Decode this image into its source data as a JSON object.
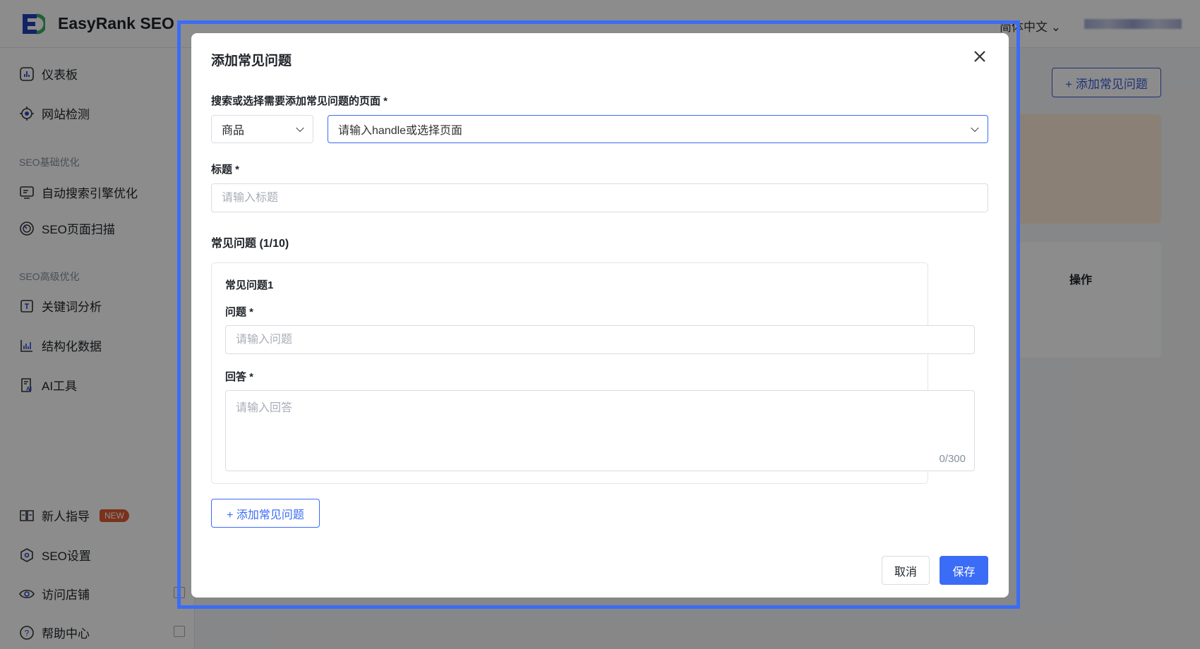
{
  "header": {
    "brand": "EasyRank SEO",
    "language": "简体中文"
  },
  "sidebar": {
    "items": [
      {
        "label": "仪表板",
        "icon": "dashboard-icon"
      },
      {
        "label": "网站检测",
        "icon": "target-icon"
      },
      {
        "label": "自动搜索引擎优化",
        "icon": "monitor-icon"
      },
      {
        "label": "SEO页面扫描",
        "icon": "scan-icon"
      },
      {
        "label": "关键词分析",
        "icon": "keyword-icon"
      },
      {
        "label": "结构化数据",
        "icon": "chart-icon"
      },
      {
        "label": "AI工具",
        "icon": "ai-doc-icon"
      },
      {
        "label": "新人指导",
        "icon": "book-icon",
        "badge": "NEW"
      },
      {
        "label": "SEO设置",
        "icon": "hexagon-settings-icon"
      },
      {
        "label": "访问店铺",
        "icon": "eye-icon"
      },
      {
        "label": "帮助中心",
        "icon": "help-icon"
      }
    ],
    "sections": [
      "SEO基础优化",
      "SEO高级优化"
    ]
  },
  "background": {
    "add_faq_button": "+ 添加常见问题",
    "table_header_action": "操作"
  },
  "modal": {
    "title": "添加常见问题",
    "page_label": "搜索或选择需要添加常见问题的页面 *",
    "page_type": "商品",
    "page_placeholder": "请输入handle或选择页面",
    "title_label": "标题 *",
    "title_placeholder": "请输入标题",
    "faq_section": "常见问题 (1/10)",
    "faq_item": {
      "heading": "常见问题1",
      "question_label": "问题 *",
      "question_placeholder": "请输入问题",
      "answer_label": "回答 *",
      "answer_placeholder": "请输入回答",
      "answer_count": "0/300"
    },
    "add_faq": "+ 添加常见问题",
    "cancel": "取消",
    "save": "保存"
  },
  "colors": {
    "primary": "#3b6cf6",
    "highlight": "#3b6cf6",
    "badge": "#e05a32"
  }
}
